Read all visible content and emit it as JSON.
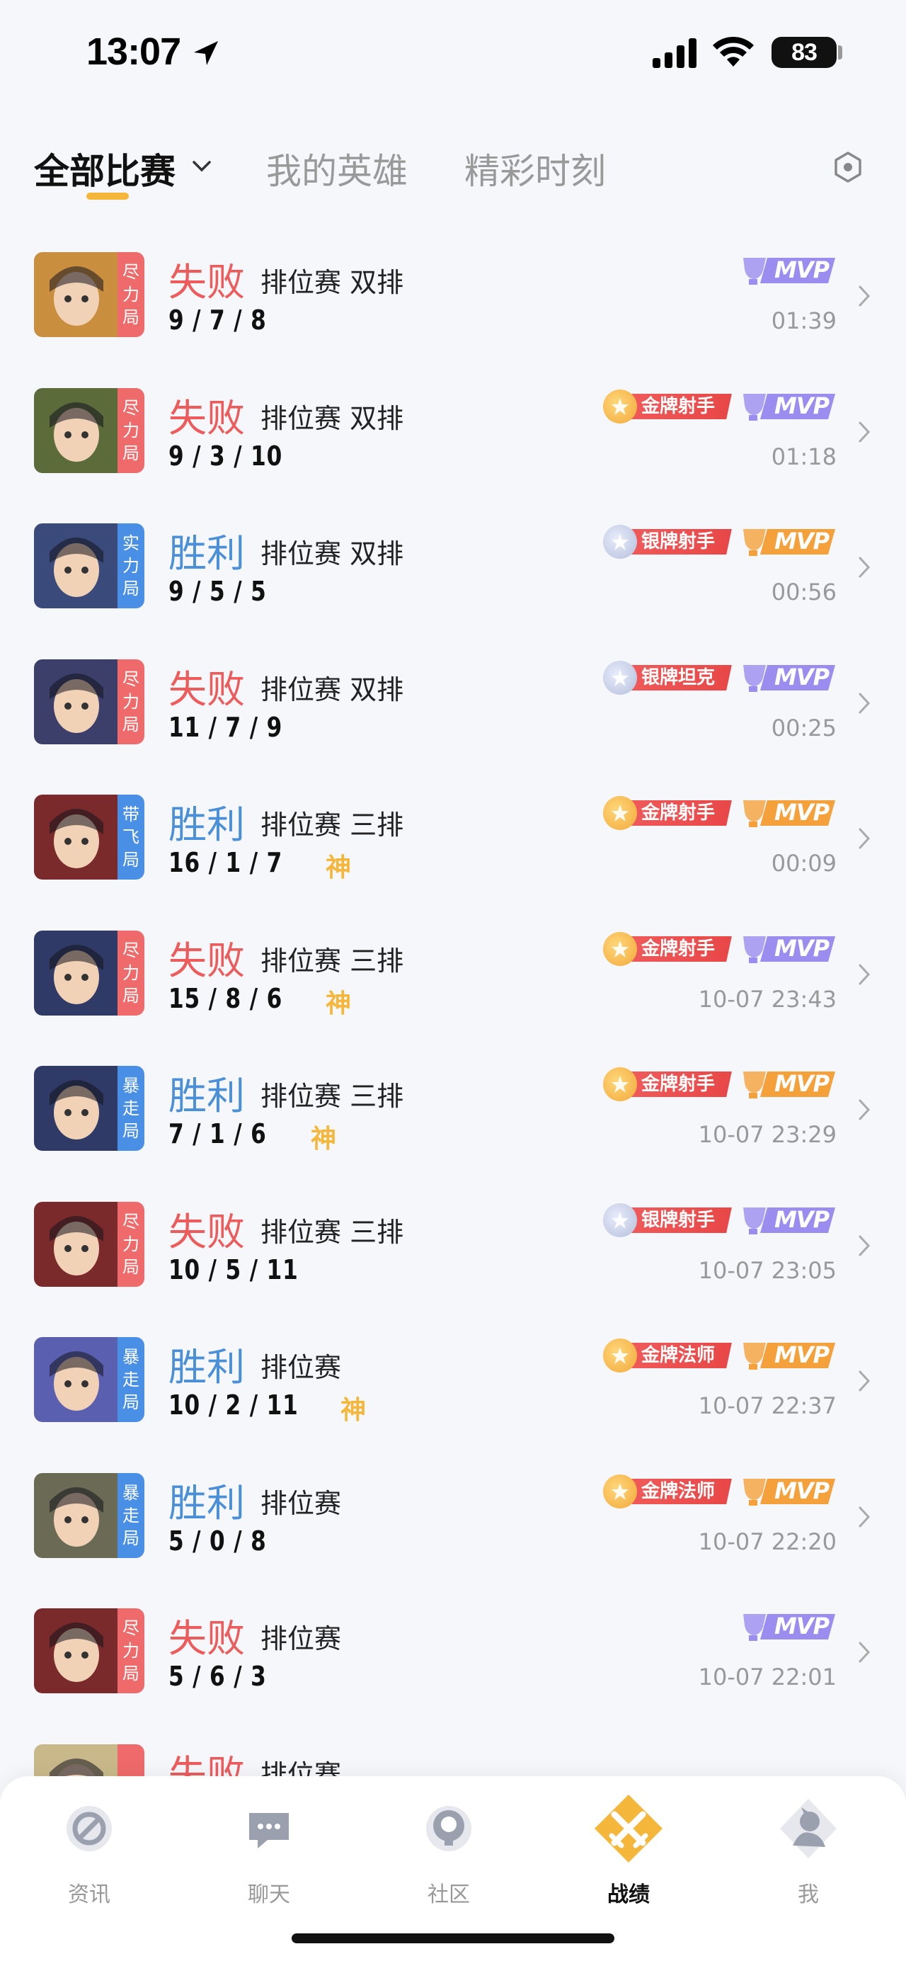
{
  "status_bar": {
    "time": "13:07",
    "battery": "83"
  },
  "tabs": [
    {
      "label": "全部比赛"
    },
    {
      "label": "我的英雄"
    },
    {
      "label": "精彩时刻"
    }
  ],
  "matches": [
    {
      "result": "失败",
      "result_type": "lose",
      "mode": "排位赛 双排",
      "kda": "9 / 7 / 8",
      "god": "",
      "time": "01:39",
      "tag": "尽力局",
      "tag_color": "red",
      "hero_color": "#c98f3e",
      "badges": [
        "mvp-purple"
      ]
    },
    {
      "result": "失败",
      "result_type": "lose",
      "mode": "排位赛 双排",
      "kda": "9 / 3 / 10",
      "god": "",
      "time": "01:18",
      "tag": "尽力局",
      "tag_color": "red",
      "hero_color": "#5b6b3a",
      "badges": [
        "gold-medal",
        "mvp-purple"
      ],
      "medal": "金牌射手"
    },
    {
      "result": "胜利",
      "result_type": "win",
      "mode": "排位赛 双排",
      "kda": "9 / 5 / 5",
      "god": "",
      "time": "00:56",
      "tag": "实力局",
      "tag_color": "blue",
      "hero_color": "#3a4a7a",
      "badges": [
        "silver-medal",
        "mvp-gold"
      ],
      "medal": "银牌射手"
    },
    {
      "result": "失败",
      "result_type": "lose",
      "mode": "排位赛 双排",
      "kda": "11 / 7 / 9",
      "god": "",
      "time": "00:25",
      "tag": "尽力局",
      "tag_color": "red",
      "hero_color": "#3b3f6a",
      "badges": [
        "silver-medal",
        "mvp-purple"
      ],
      "medal": "银牌坦克"
    },
    {
      "result": "胜利",
      "result_type": "win",
      "mode": "排位赛 三排",
      "kda": "16 / 1 / 7",
      "god": "神",
      "time": "00:09",
      "tag": "带飞局",
      "tag_color": "blue",
      "hero_color": "#7a2a2a",
      "badges": [
        "gold-medal",
        "mvp-gold"
      ],
      "medal": "金牌射手"
    },
    {
      "result": "失败",
      "result_type": "lose",
      "mode": "排位赛 三排",
      "kda": "15 / 8 / 6",
      "god": "神",
      "time": "10-07 23:43",
      "tag": "尽力局",
      "tag_color": "red",
      "hero_color": "#2f3a66",
      "badges": [
        "gold-medal",
        "mvp-purple"
      ],
      "medal": "金牌射手"
    },
    {
      "result": "胜利",
      "result_type": "win",
      "mode": "排位赛 三排",
      "kda": "7 / 1 / 6",
      "god": "神",
      "time": "10-07 23:29",
      "tag": "暴走局",
      "tag_color": "blue",
      "hero_color": "#2f3a66",
      "badges": [
        "gold-medal",
        "mvp-gold"
      ],
      "medal": "金牌射手"
    },
    {
      "result": "失败",
      "result_type": "lose",
      "mode": "排位赛 三排",
      "kda": "10 / 5 / 11",
      "god": "",
      "time": "10-07 23:05",
      "tag": "尽力局",
      "tag_color": "red",
      "hero_color": "#7a2a2a",
      "badges": [
        "silver-medal",
        "mvp-purple"
      ],
      "medal": "银牌射手"
    },
    {
      "result": "胜利",
      "result_type": "win",
      "mode": "排位赛",
      "kda": "10 / 2 / 11",
      "god": "神",
      "time": "10-07 22:37",
      "tag": "暴走局",
      "tag_color": "blue",
      "hero_color": "#5a5fb0",
      "badges": [
        "gold-medal",
        "mvp-gold"
      ],
      "medal": "金牌法师"
    },
    {
      "result": "胜利",
      "result_type": "win",
      "mode": "排位赛",
      "kda": "5 / 0 / 8",
      "god": "",
      "time": "10-07 22:20",
      "tag": "暴走局",
      "tag_color": "blue",
      "hero_color": "#6b6a55",
      "badges": [
        "gold-medal",
        "mvp-gold"
      ],
      "medal": "金牌法师"
    },
    {
      "result": "失败",
      "result_type": "lose",
      "mode": "排位赛",
      "kda": "5 / 6 / 3",
      "god": "",
      "time": "10-07 22:01",
      "tag": "尽力局",
      "tag_color": "red",
      "hero_color": "#7a2a2a",
      "badges": [
        "mvp-purple"
      ]
    },
    {
      "result": "失败",
      "result_type": "lose",
      "mode": "排位赛",
      "kda": "",
      "god": "",
      "time": "",
      "tag": "尽",
      "tag_color": "red",
      "hero_color": "#c9b98a",
      "badges": []
    }
  ],
  "badge_labels": {
    "mvp": "MVP"
  },
  "nav": [
    {
      "label": "资讯",
      "icon": "news-icon"
    },
    {
      "label": "聊天",
      "icon": "chat-icon"
    },
    {
      "label": "社区",
      "icon": "community-icon"
    },
    {
      "label": "战绩",
      "icon": "record-icon"
    },
    {
      "label": "我",
      "icon": "profile-icon"
    }
  ],
  "colors": {
    "accent": "#f5b73b",
    "lose": "#ee5b5b",
    "win": "#4a90d9",
    "mvp_purple": "#9b8cf0",
    "mvp_gold": "#f5a13b",
    "medal_red": "#e84747"
  }
}
